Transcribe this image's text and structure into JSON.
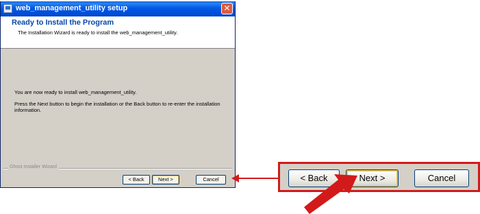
{
  "window": {
    "title": "web_management_utility setup",
    "close_glyph": "✕"
  },
  "header": {
    "title": "Ready to Install the Program",
    "subtitle": "The Installation Wizard is ready to install the web_management_utility."
  },
  "body": {
    "line1": "You are now ready to install web_management_utility.",
    "line2": "Press the Next button to begin the installation or the Back button to re-enter the installation information."
  },
  "footer": {
    "group_label": "Ghost Installer Wizard",
    "back_label": "< Back",
    "next_label": "Next >",
    "cancel_label": "Cancel"
  },
  "zoom": {
    "back_label": "< Back",
    "next_label": "Next >",
    "cancel_label": "Cancel"
  },
  "colors": {
    "highlight": "#d21a1a",
    "titlebar": "#0058e6",
    "header_title": "#0848a8"
  },
  "icons": {
    "app": "setup-app-icon",
    "close": "close-icon",
    "arrow": "left-arrow-icon",
    "pointer": "pointer-arrow-icon"
  }
}
